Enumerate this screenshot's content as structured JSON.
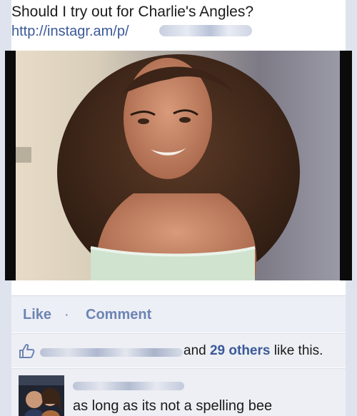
{
  "post": {
    "text": "Should I try out for Charlie's Angles?",
    "link_prefix": "http://instagr.am/p/"
  },
  "actions": {
    "like_label": "Like",
    "separator": "·",
    "comment_label": "Comment"
  },
  "likes": {
    "suffix_before": "and ",
    "others_label": "29 others",
    "suffix_after": " like this."
  },
  "comment": {
    "text": "as long as its not a spelling bee"
  },
  "icons": {
    "like": "thumbs-up-icon"
  },
  "colors": {
    "link": "#3b5998",
    "action": "#6d84b4",
    "background": "#dfe3ee"
  }
}
